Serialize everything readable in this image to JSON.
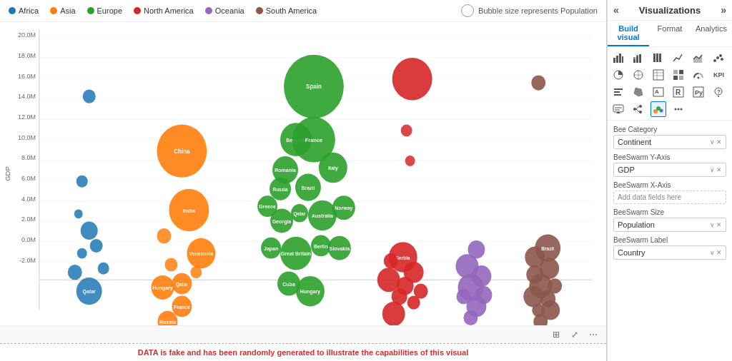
{
  "legend": {
    "items": [
      {
        "label": "Africa",
        "color": "#1f77b4"
      },
      {
        "label": "Asia",
        "color": "#ff7f0e"
      },
      {
        "label": "Europe",
        "color": "#2ca02c"
      },
      {
        "label": "North America",
        "color": "#d62728"
      },
      {
        "label": "Oceania",
        "color": "#9467bd"
      },
      {
        "label": "South America",
        "color": "#8c564b"
      }
    ],
    "bubble_size_label": "Bubble size represents Population"
  },
  "chart": {
    "y_axis_label": "GDP",
    "y_ticks": [
      "20.0M",
      "18.0M",
      "16.0M",
      "14.0M",
      "12.0M",
      "10.0M",
      "8.0M",
      "6.0M",
      "4.0M",
      "2.0M",
      "0.0M",
      "-2.0M"
    ],
    "disclaimer": "DATA is fake and has been randomly generated to illustrate the capabilities of this visual"
  },
  "visualizations": {
    "title": "Visualizations",
    "collapse_left": "«",
    "expand_right": "»",
    "tabs": [
      {
        "label": "Build visual",
        "active": true
      },
      {
        "label": "Format",
        "active": false
      },
      {
        "label": "Analytics",
        "active": false
      }
    ]
  },
  "fields": {
    "bee_category": {
      "label": "Bee Category",
      "value": "Continent",
      "icons": [
        "∨",
        "✕"
      ]
    },
    "bee_swarm_y_axis": {
      "label": "BeeSwarm Y-Axis",
      "value": "GDP",
      "icons": [
        "∨",
        "✕"
      ]
    },
    "bee_swarm_x_axis": {
      "label": "BeeSwarm X-Axis",
      "placeholder": "Add data fields here"
    },
    "bee_swarm_size": {
      "label": "BeeSwarm Size",
      "value": "Population",
      "icons": [
        "∨",
        "✕"
      ]
    },
    "bee_swarm_label": {
      "label": "BeeSwarm Label",
      "value": "Country",
      "icons": [
        "∨",
        "✕"
      ]
    }
  }
}
